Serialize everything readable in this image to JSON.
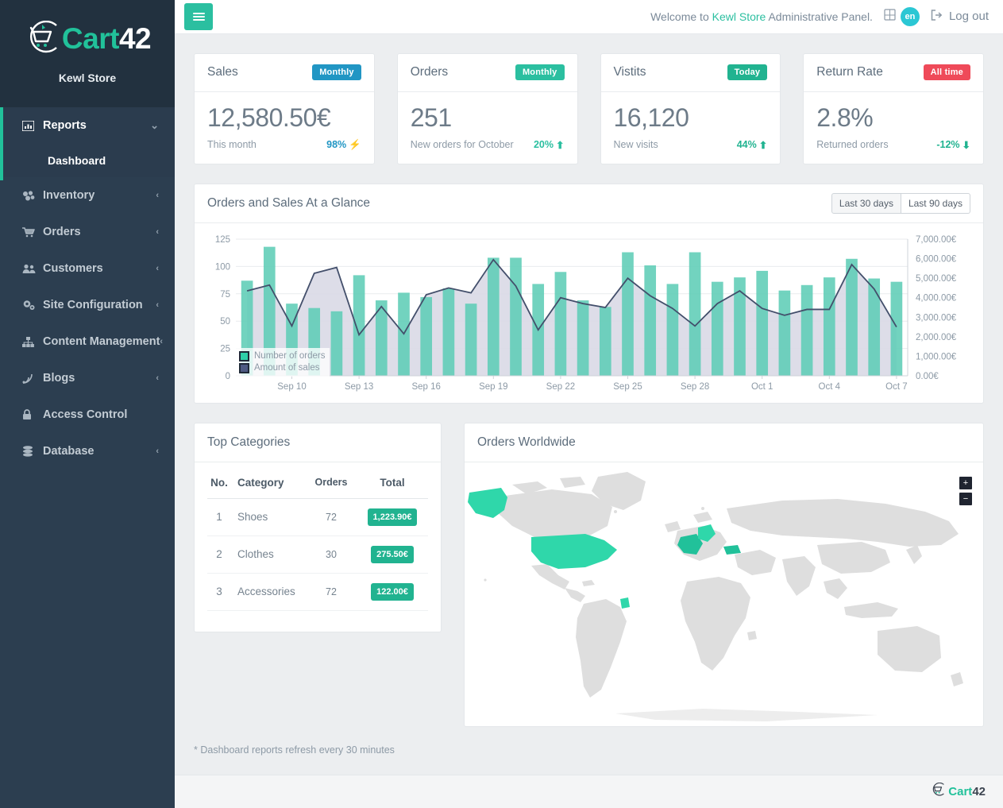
{
  "brand": {
    "name_part1": "Cart",
    "name_part2": "42",
    "store": "Kewl Store",
    "logo_icon": "cart-logo-icon"
  },
  "sidebar": {
    "groups": [
      {
        "label": "Reports",
        "icon": "chart-bar-icon",
        "caret": "⌄",
        "active": true,
        "children": [
          {
            "label": "Dashboard"
          }
        ]
      },
      {
        "label": "Inventory",
        "icon": "boxes-icon",
        "caret": "‹",
        "active": false,
        "children": []
      },
      {
        "label": "Orders",
        "icon": "shopping-cart-icon",
        "caret": "‹",
        "active": false,
        "children": []
      },
      {
        "label": "Customers",
        "icon": "users-icon",
        "caret": "‹",
        "active": false,
        "children": []
      },
      {
        "label": "Site Configuration",
        "icon": "gears-icon",
        "caret": "‹",
        "active": false,
        "children": []
      },
      {
        "label": "Content Management",
        "icon": "sitemap-icon",
        "caret": "‹",
        "active": false,
        "children": []
      },
      {
        "label": "Blogs",
        "icon": "rss-icon",
        "caret": "‹",
        "active": false,
        "children": []
      },
      {
        "label": "Access Control",
        "icon": "lock-icon",
        "caret": "",
        "active": false,
        "children": []
      },
      {
        "label": "Database",
        "icon": "database-icon",
        "caret": "‹",
        "active": false,
        "children": []
      }
    ]
  },
  "topbar": {
    "menu_toggle": "hamburger-icon",
    "welcome_prefix": "Welcome to ",
    "welcome_store": "Kewl Store",
    "welcome_suffix": " Administrative Panel.",
    "lang_flag_icon": "flag-icon",
    "lang_code": "en",
    "logout_icon": "sign-out-icon",
    "logout_label": "Log out"
  },
  "stats": [
    {
      "title": "Sales",
      "badge": "Monthly",
      "badge_color": "#2196c4",
      "value": "12,580.50€",
      "sub": "This month",
      "delta": "98%",
      "delta_color": "#2196c4",
      "delta_icon": "⚡"
    },
    {
      "title": "Orders",
      "badge": "Monthly",
      "badge_color": "#2bbfa0",
      "value": "251",
      "sub": "New orders for October",
      "delta": "20%",
      "delta_color": "#2bbfa0",
      "delta_icon": "⬆"
    },
    {
      "title": "Vistits",
      "badge": "Today",
      "badge_color": "#21b390",
      "value": "16,120",
      "sub": "New visits",
      "delta": "44%",
      "delta_color": "#21b390",
      "delta_icon": "⬆"
    },
    {
      "title": "Return Rate",
      "badge": "All time",
      "badge_color": "#ef4a59",
      "value": "2.8%",
      "sub": "Returned orders",
      "delta": "-12%",
      "delta_color": "#21b390",
      "delta_icon": "⬇"
    }
  ],
  "glance": {
    "title": "Orders and Sales At a Glance",
    "buttons": [
      "Last 30 days",
      "Last 90 days"
    ]
  },
  "chart_data": {
    "type": "bar",
    "title": "Orders and Sales At a Glance",
    "xlabel": "",
    "ylabel": "Number of orders",
    "y2label": "Amount of sales",
    "ylim": [
      0,
      125
    ],
    "y2lim": [
      0,
      7000
    ],
    "yticks": [
      0,
      25,
      50,
      75,
      100,
      125
    ],
    "y2ticks": [
      "0.00€",
      "1,000.00€",
      "2,000.00€",
      "3,000.00€",
      "4,000.00€",
      "5,000.00€",
      "6,000.00€",
      "7,000.00€"
    ],
    "grid": true,
    "legend_position": "bottom-left",
    "legend": [
      "Number of orders",
      "Amount of sales"
    ],
    "colors": {
      "bars": "#6bcfba",
      "line": "#46506b",
      "area": "#d9d9e6"
    },
    "xtick_labels": [
      "Sep 10",
      "Sep 13",
      "Sep 16",
      "Sep 19",
      "Sep 22",
      "Sep 25",
      "Sep 28",
      "Oct 1",
      "Oct 4",
      "Oct 7"
    ],
    "xtick_indices": [
      2,
      5,
      8,
      11,
      14,
      17,
      20,
      23,
      26,
      29
    ],
    "x": [
      "Sep 8",
      "Sep 9",
      "Sep 10",
      "Sep 11",
      "Sep 12",
      "Sep 13",
      "Sep 14",
      "Sep 15",
      "Sep 16",
      "Sep 17",
      "Sep 18",
      "Sep 19",
      "Sep 20",
      "Sep 21",
      "Sep 22",
      "Sep 23",
      "Sep 24",
      "Sep 25",
      "Sep 26",
      "Sep 27",
      "Sep 28",
      "Sep 29",
      "Sep 30",
      "Oct 1",
      "Oct 2",
      "Oct 3",
      "Oct 4",
      "Oct 5",
      "Oct 6",
      "Oct 7"
    ],
    "series": [
      {
        "name": "Number of orders",
        "type": "bar",
        "axis": "left",
        "values": [
          87,
          118,
          66,
          62,
          59,
          92,
          69,
          76,
          72,
          80,
          66,
          108,
          108,
          84,
          95,
          69,
          63,
          113,
          101,
          84,
          113,
          86,
          90,
          96,
          78,
          83,
          90,
          107,
          89,
          86
        ]
      },
      {
        "name": "Amount of sales",
        "type": "area-line",
        "axis": "right",
        "values": [
          4350,
          4650,
          2550,
          5250,
          5550,
          2100,
          3550,
          2150,
          4150,
          4500,
          4250,
          5950,
          4600,
          2350,
          4000,
          3700,
          3500,
          5000,
          4100,
          3450,
          2550,
          3700,
          4350,
          3450,
          3100,
          3400,
          3400,
          5700,
          4450,
          2500
        ]
      }
    ]
  },
  "categories": {
    "title": "Top Categories",
    "columns": [
      "No.",
      "Category",
      "Orders",
      "Total"
    ],
    "rows": [
      {
        "no": "1",
        "category": "Shoes",
        "orders": "72",
        "total": "1,223.90€"
      },
      {
        "no": "2",
        "category": "Clothes",
        "orders": "30",
        "total": "275.50€"
      },
      {
        "no": "3",
        "category": "Accessories",
        "orders": "72",
        "total": "122.00€"
      }
    ]
  },
  "map": {
    "title": "Orders Worldwide",
    "zoom_in": "+",
    "zoom_out": "−",
    "highlight_color": "#2fd7aa",
    "base_color": "#dedede",
    "highlighted_regions": [
      "United States",
      "Alaska",
      "France",
      "Germany",
      "Turkey",
      "French Guiana"
    ]
  },
  "note": "* Dashboard reports refresh every 30 minutes",
  "footer": {
    "name_part1": "Cart",
    "name_part2": "42",
    "logo_icon": "cart-logo-icon"
  }
}
